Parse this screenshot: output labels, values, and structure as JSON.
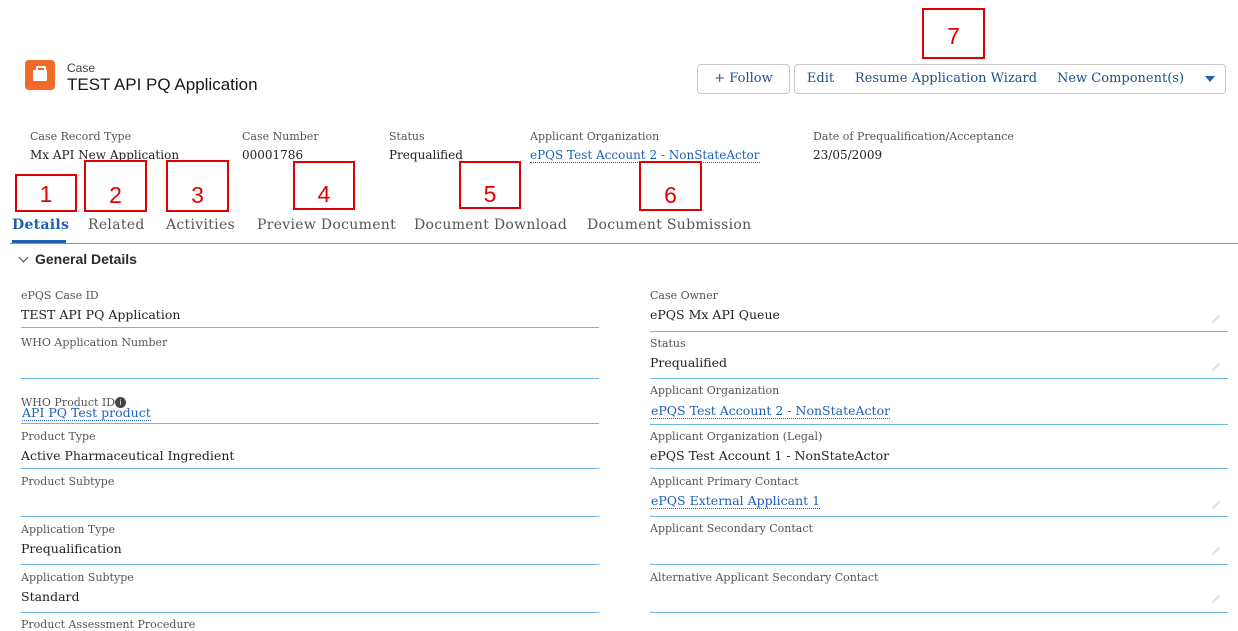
{
  "header": {
    "object_label": "Case",
    "title": "TEST API PQ Application",
    "buttons": {
      "follow": "+ Follow",
      "edit": "Edit",
      "resume": "Resume Application Wizard",
      "new_component": "New Component(s)"
    }
  },
  "highlights": [
    {
      "label": "Case Record Type",
      "value": "Mx API New Application"
    },
    {
      "label": "Case Number",
      "value": "00001786"
    },
    {
      "label": "Status",
      "value": "Prequalified"
    },
    {
      "label": "Applicant Organization",
      "value": "ePQS Test Account 2 - NonStateActor"
    },
    {
      "label": "Date of Prequalification/Acceptance",
      "value": "23/05/2009"
    }
  ],
  "tabs": [
    "Details",
    "Related",
    "Activities",
    "Preview Document",
    "Document Download",
    "Document Submission"
  ],
  "annotations": [
    "1",
    "2",
    "3",
    "4",
    "5",
    "6",
    "7"
  ],
  "section": {
    "title": "General Details",
    "left_fields": [
      {
        "label": "ePQS Case ID",
        "value": "TEST API PQ Application"
      },
      {
        "label": "WHO Application Number",
        "value": ""
      },
      {
        "label": "WHO Product ID",
        "value": "API PQ Test product"
      },
      {
        "label": "Product Type",
        "value": "Active Pharmaceutical Ingredient"
      },
      {
        "label": "Product Subtype",
        "value": ""
      },
      {
        "label": "Application Type",
        "value": "Prequalification"
      },
      {
        "label": "Application Subtype",
        "value": "Standard"
      },
      {
        "label": "Product Assessment Procedure",
        "value": ""
      }
    ],
    "right_fields": [
      {
        "label": "Case Owner",
        "value": "ePQS Mx API Queue"
      },
      {
        "label": "Status",
        "value": "Prequalified"
      },
      {
        "label": "Applicant Organization",
        "value": "ePQS Test Account 2 - NonStateActor"
      },
      {
        "label": "Applicant Organization (Legal)",
        "value": "ePQS Test Account 1 - NonStateActor"
      },
      {
        "label": "Applicant Primary Contact",
        "value": "ePQS External Applicant 1"
      },
      {
        "label": "Applicant Secondary Contact",
        "value": ""
      },
      {
        "label": "Alternative Applicant Secondary Contact",
        "value": ""
      }
    ]
  },
  "colors": {
    "accent": "#1d5fb4",
    "annotation": "#e00000",
    "case_icon": "#f06a2b"
  }
}
